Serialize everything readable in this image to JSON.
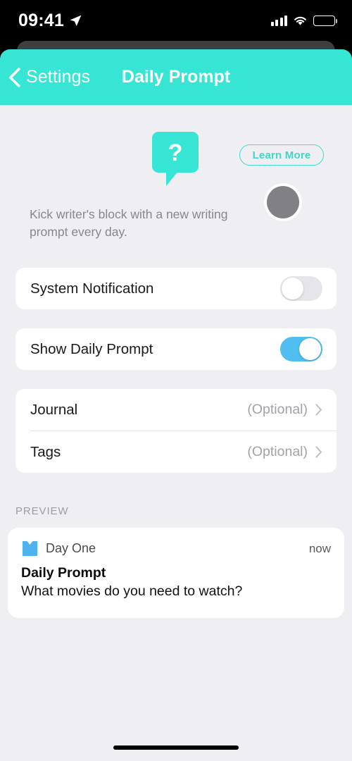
{
  "status_bar": {
    "time": "09:41",
    "location_icon": "location-arrow-icon",
    "signal_icon": "cellular-signal-icon",
    "wifi_icon": "wifi-icon",
    "battery_icon": "battery-full-icon"
  },
  "nav": {
    "back_label": "Settings",
    "back_icon": "chevron-left-icon",
    "title": "Daily Prompt",
    "background_color": "#36E5D3"
  },
  "hero": {
    "bubble_icon": "question-speech-bubble-icon",
    "bubble_color": "#36E5D3",
    "bubble_glyph": "?",
    "learn_more_label": "Learn More",
    "learn_more_color": "#3ED7C6",
    "description": "Kick writer's block with a new writing prompt every day."
  },
  "settings": {
    "toggles": [
      {
        "label": "System Notification",
        "state": "off",
        "color": "#E6E6EA"
      },
      {
        "label": "Show Daily Prompt",
        "state": "on",
        "color": "#50BEF0"
      }
    ],
    "list_rows": [
      {
        "label": "Journal",
        "value": "(Optional)",
        "chevron_icon": "chevron-right-icon"
      },
      {
        "label": "Tags",
        "value": "(Optional)",
        "chevron_icon": "chevron-right-icon"
      }
    ]
  },
  "preview": {
    "section_label": "PREVIEW",
    "app_icon": "day-one-bookmark-icon",
    "app_icon_color": "#4FB3F0",
    "app_name": "Day One",
    "time": "now",
    "title": "Daily Prompt",
    "body": "What movies do you need to watch?"
  },
  "overlay": {
    "touch_indicator": "touch-point-indicator",
    "touch_color": "#808085"
  },
  "system": {
    "home_indicator": "home-indicator-bar",
    "background_color": "#EFEFF3"
  }
}
